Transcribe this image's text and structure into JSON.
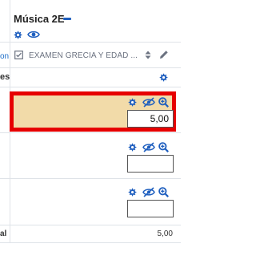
{
  "course": {
    "title": "Música 2E",
    "collapse_icon": "minus-icon",
    "actions": [
      "gear-icon",
      "eye-icon"
    ]
  },
  "left_column": {
    "cut_link": "on",
    "cut_label": "es",
    "cut_total_label": "al"
  },
  "grade_item": {
    "label": "EXAMEN GRECIA Y EDAD ...",
    "item_icon": "assignment-icon",
    "sort_icon": "sort-icon",
    "edit_icon": "pencil-icon"
  },
  "category": {
    "action_icon": "gear-icon"
  },
  "rows": [
    {
      "value": "5,00",
      "highlighted": true,
      "icons": [
        "gear-icon",
        "eye-slash-icon",
        "zoom-in-icon"
      ]
    },
    {
      "value": "",
      "highlighted": false,
      "icons": [
        "gear-icon",
        "eye-slash-icon",
        "zoom-in-icon"
      ]
    },
    {
      "value": "",
      "highlighted": false,
      "icons": [
        "gear-icon",
        "eye-slash-icon",
        "zoom-in-icon"
      ]
    }
  ],
  "overall_total": "5,00",
  "colors": {
    "highlight_bg": "#f2dba9",
    "highlight_border": "#e60000",
    "accent": "#1f5fbf"
  }
}
